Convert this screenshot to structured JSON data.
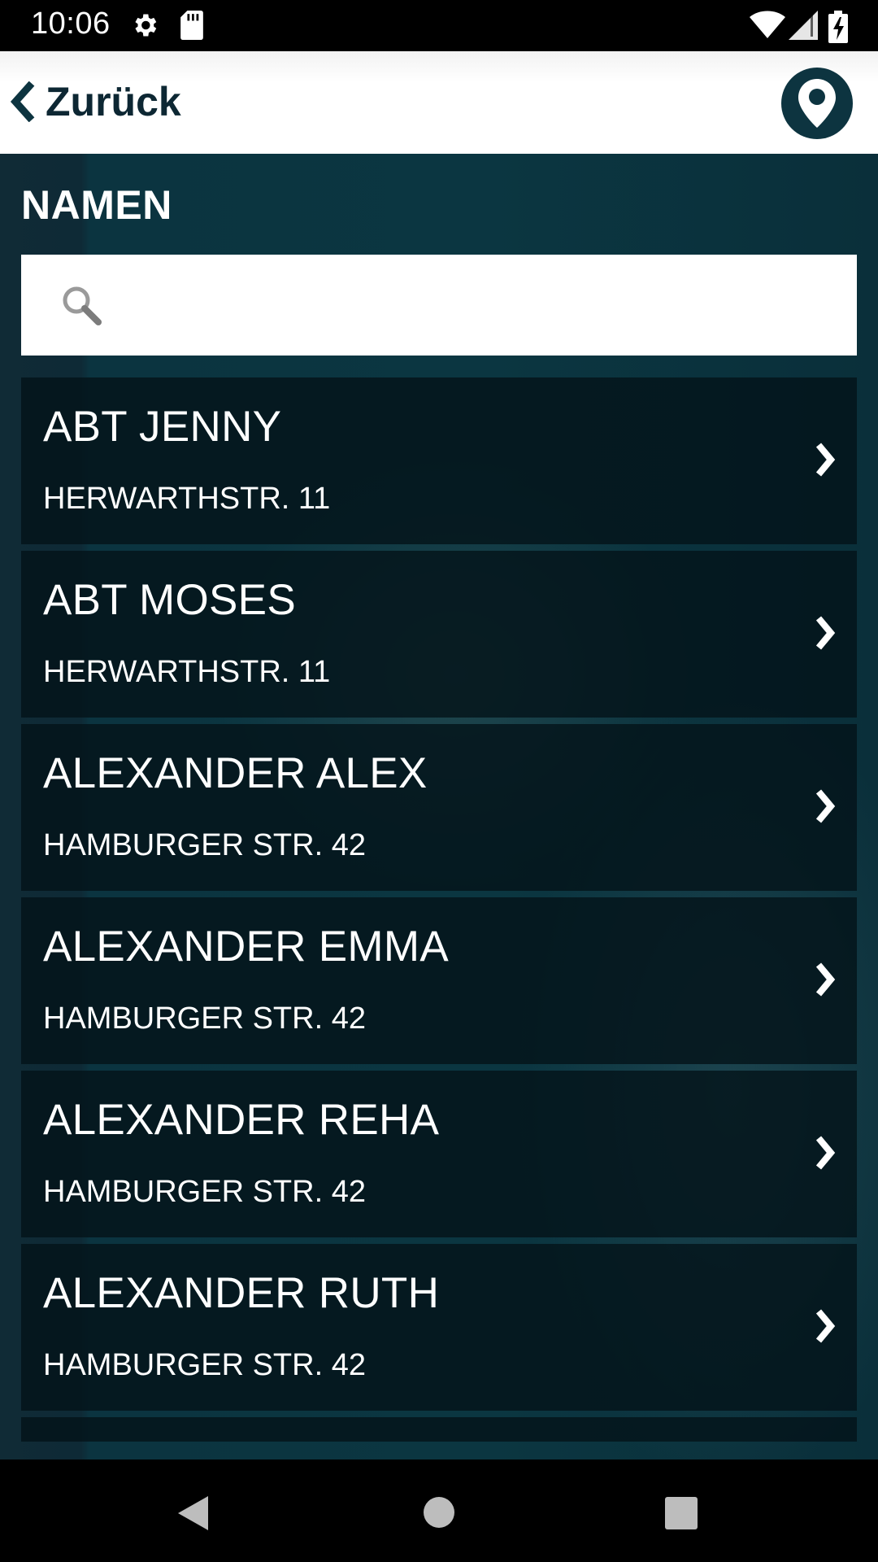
{
  "status_bar": {
    "time": "10:06",
    "icons": [
      "gear-icon",
      "sd-card-icon",
      "wifi-icon",
      "signal-icon",
      "battery-charging-icon"
    ]
  },
  "header": {
    "back_label": "Zurück",
    "map_icon": "location-pin-icon"
  },
  "section": {
    "title": "NAMEN"
  },
  "search": {
    "value": "",
    "placeholder": ""
  },
  "list": {
    "items": [
      {
        "name": "ABT JENNY",
        "address": "HERWARTHSTR. 11"
      },
      {
        "name": "ABT MOSES",
        "address": "HERWARTHSTR. 11"
      },
      {
        "name": "ALEXANDER ALEX",
        "address": "HAMBURGER STR. 42"
      },
      {
        "name": "ALEXANDER EMMA",
        "address": "HAMBURGER STR. 42"
      },
      {
        "name": "ALEXANDER REHA",
        "address": "HAMBURGER STR. 42"
      },
      {
        "name": "ALEXANDER RUTH",
        "address": "HAMBURGER STR. 42"
      }
    ]
  },
  "colors": {
    "accent_dark": "#0d3440",
    "header_text": "#0d2733",
    "content_background": "#0b3641",
    "list_item_background": "#04141a"
  }
}
